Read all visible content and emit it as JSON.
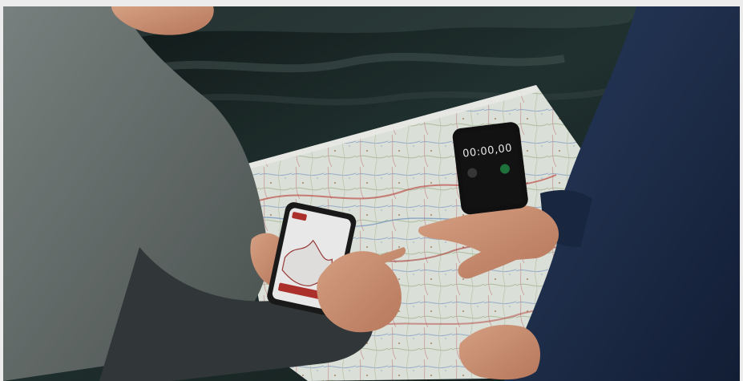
{
  "photo": {
    "phone_left": {
      "app_badge": "",
      "route_label": "",
      "button_label": ""
    },
    "phone_right": {
      "stopwatch": "00:00,00"
    }
  },
  "colors": {
    "background_frame": "#ececec",
    "water": "#1d2a29",
    "map_paper": "#e9eee7",
    "shirt_left": "#6c7472",
    "shirt_right": "#1f3150",
    "skin": "#d79a7d"
  }
}
